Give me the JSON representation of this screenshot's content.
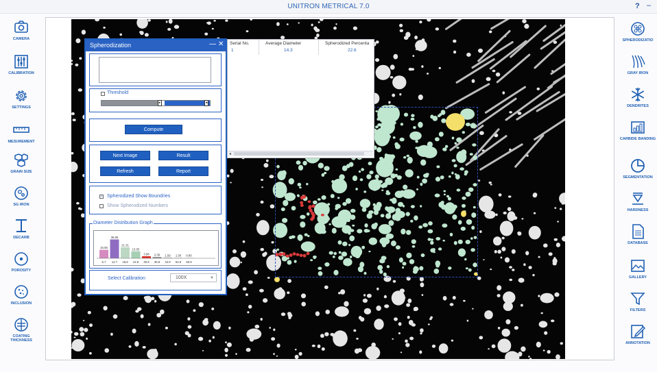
{
  "app": {
    "title": "UNITRON METRICAL 7.0",
    "help": "?",
    "minimize": "–"
  },
  "left_sidebar": [
    {
      "id": "camera",
      "label": "CAMERA",
      "icon": "camera-icon"
    },
    {
      "id": "calibration",
      "label": "CALIBRATION",
      "icon": "sliders-icon"
    },
    {
      "id": "settings",
      "label": "SETTINGS",
      "icon": "gear-icon"
    },
    {
      "id": "measurement",
      "label": "MESUREMENT",
      "icon": "ruler-icon"
    },
    {
      "id": "grain-size",
      "label": "GRAIN SIZE",
      "icon": "grain-icon"
    },
    {
      "id": "sg-iron",
      "label": "SG IRON",
      "icon": "nodule-icon"
    },
    {
      "id": "decarb",
      "label": "DECARB",
      "icon": "decarb-icon"
    },
    {
      "id": "porosity",
      "label": "POROSITY",
      "icon": "porosity-icon"
    },
    {
      "id": "inclusion",
      "label": "INCLUSION",
      "icon": "inclusion-icon"
    },
    {
      "id": "coating",
      "label": "COATING THICKNESS",
      "icon": "coating-icon"
    }
  ],
  "right_sidebar": [
    {
      "id": "spherodization",
      "label": "SPHERODIZATIO",
      "icon": "spherodization-icon"
    },
    {
      "id": "gray-iron",
      "label": "GRAY IRON",
      "icon": "flakes-icon"
    },
    {
      "id": "dendrites",
      "label": "DENDRITES",
      "icon": "snowflake-icon"
    },
    {
      "id": "carbide-banding",
      "label": "CARBIDE BANDING",
      "icon": "bar-chart-icon"
    },
    {
      "id": "segmentation",
      "label": "SEGMENTATION",
      "icon": "pie-icon"
    },
    {
      "id": "hardness",
      "label": "HARDNESS",
      "icon": "indenter-icon"
    },
    {
      "id": "database",
      "label": "DATABASE",
      "icon": "document-icon"
    },
    {
      "id": "gallery",
      "label": "GALLERY",
      "icon": "image-icon"
    },
    {
      "id": "filters",
      "label": "FILTERS",
      "icon": "funnel-icon"
    },
    {
      "id": "annotation",
      "label": "ANNOTATION",
      "icon": "pencil-icon"
    }
  ],
  "results_table": {
    "headers": [
      "Serial No.",
      "Average Diameter",
      "Spherodized Percenta"
    ],
    "rows": [
      [
        "1",
        "14.3",
        "22.6"
      ]
    ]
  },
  "spherodization": {
    "title": "Spherodization",
    "minimize": "—",
    "close": "✕",
    "threshold_label": "Threshold",
    "threshold_enabled": false,
    "compute": "Compute",
    "next_image": "Next Image",
    "result": "Result",
    "refresh": "Refresh",
    "report": "Report",
    "show_boundaries": {
      "label": "Spherodized Show Boundries",
      "checked": true
    },
    "show_numbers": {
      "label": "Show Spherodized Numbers",
      "checked": false
    },
    "graph_title": "Diameter Distribution Graph",
    "calibration_label": "Select Calibration",
    "calibration_value": "100X"
  },
  "chart_data": {
    "type": "bar",
    "title": "Diameter Distribution Graph",
    "categories": [
      "6.7",
      "12.7",
      "18.8",
      "24.8",
      "30.8",
      "36.8",
      "42.9",
      "54.9",
      "60.9"
    ],
    "values": [
      16.55,
      36.65,
      21.31,
      13.55,
      3.98,
      2.39,
      1.59,
      1.3,
      0.8
    ],
    "value_labels": [
      "16.55",
      "36.65",
      "21.31",
      "13.55",
      "3.98",
      "2.39",
      "1.59",
      "1.30",
      "0.80"
    ],
    "colors": [
      "#d58bc0",
      "#8f6cc2",
      "#bcd8c4",
      "#a6cfb3",
      "#d9362b",
      "#8b8b8b",
      "#c2c2c2",
      "#d9d9d9",
      "#e6e6e6"
    ],
    "ylim": [
      0,
      40
    ]
  }
}
